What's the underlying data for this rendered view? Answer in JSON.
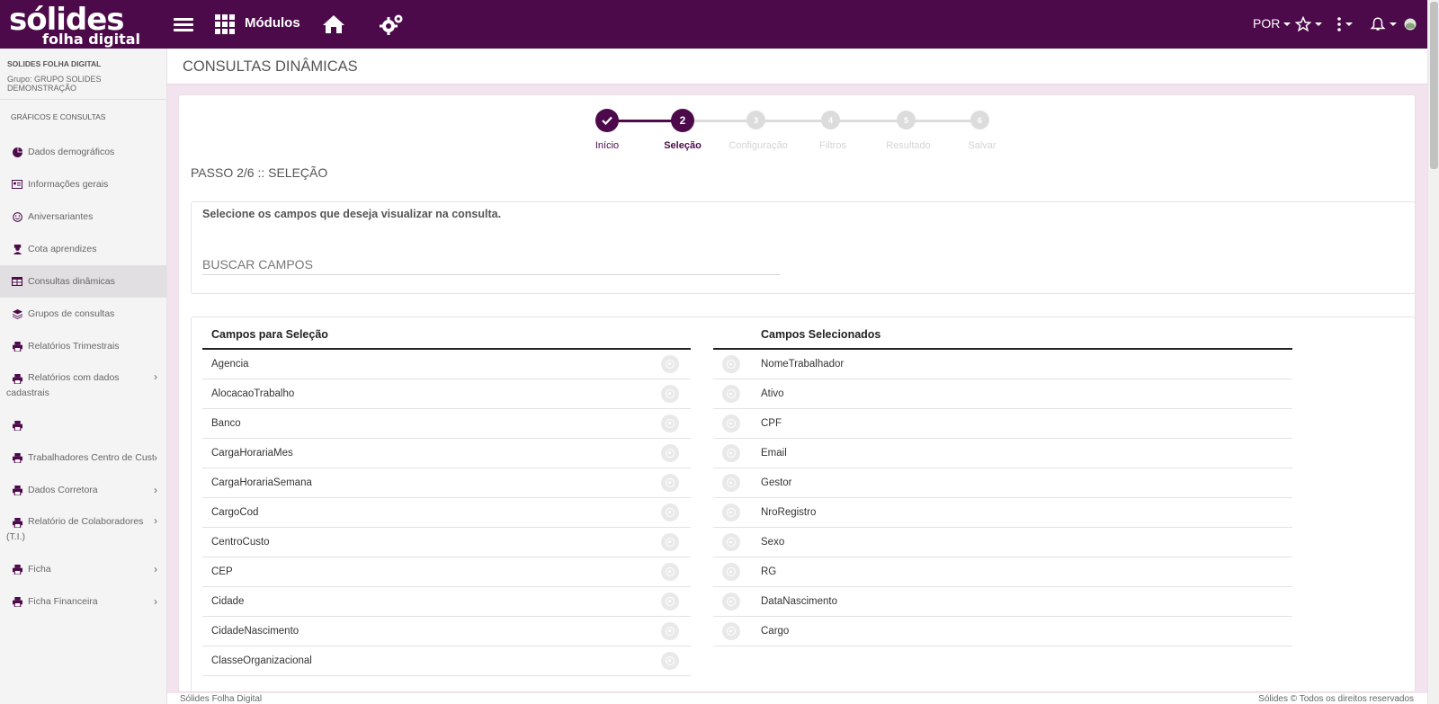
{
  "header": {
    "logo_top": "sólides",
    "logo_bottom": "folha digital",
    "modules_label": "Módulos",
    "language": "POR"
  },
  "sidebar": {
    "org_name": "SOLIDES FOLHA DIGITAL",
    "org_group": "Grupo: GRUPO SOLIDES DEMONSTRAÇÃO",
    "section_title": "GRÁFICOS E CONSULTAS",
    "items": [
      {
        "label": "Dados demográficos",
        "icon": "pie-chart-icon"
      },
      {
        "label": "Informações gerais",
        "icon": "id-card-icon"
      },
      {
        "label": "Aniversariantes",
        "icon": "smile-icon"
      },
      {
        "label": "Cota aprendizes",
        "icon": "graduation-icon"
      },
      {
        "label": "Consultas dinâmicas",
        "icon": "table-icon",
        "active": true
      },
      {
        "label": "Grupos de consultas",
        "icon": "layers-icon"
      },
      {
        "label": "Relatórios Trimestrais",
        "icon": "printer-icon"
      },
      {
        "label": "Relatórios com dados cadastrais",
        "icon": "printer-icon",
        "submenu": true
      },
      {
        "label": "",
        "icon": "printer-icon"
      },
      {
        "label": "Trabalhadores Centro de Custo",
        "icon": "printer-icon",
        "submenu": true
      },
      {
        "label": "Dados Corretora",
        "icon": "printer-icon",
        "submenu": true
      },
      {
        "label": "Relatório de Colaboradores (T.I.)",
        "icon": "printer-icon",
        "submenu": true
      },
      {
        "label": "Ficha",
        "icon": "printer-icon",
        "submenu": true
      },
      {
        "label": "Ficha Financeira",
        "icon": "printer-icon",
        "submenu": true
      }
    ]
  },
  "page": {
    "title": "CONSULTAS DINÂMICAS",
    "step_caption": "PASSO 2/6 :: SELEÇÃO",
    "description": "Selecione os campos que deseja visualizar na consulta.",
    "search_placeholder": "BUSCAR CAMPOS"
  },
  "stepper": {
    "steps": [
      {
        "number": "✓",
        "label": "Início",
        "state": "done"
      },
      {
        "number": "2",
        "label": "Seleção",
        "state": "current"
      },
      {
        "number": "3",
        "label": "Configuração",
        "state": "pending"
      },
      {
        "number": "4",
        "label": "Filtros",
        "state": "pending"
      },
      {
        "number": "5",
        "label": "Resultado",
        "state": "pending"
      },
      {
        "number": "6",
        "label": "Salvar",
        "state": "pending"
      }
    ]
  },
  "available_fields": {
    "title": "Campos para Seleção",
    "items": [
      "Agencia",
      "AlocacaoTrabalho",
      "Banco",
      "CargaHorariaMes",
      "CargaHorariaSemana",
      "CargoCod",
      "CentroCusto",
      "CEP",
      "Cidade",
      "CidadeNascimento",
      "ClasseOrganizacional"
    ]
  },
  "selected_fields": {
    "title": "Campos Selecionados",
    "items": [
      "NomeTrabalhador",
      "Ativo",
      "CPF",
      "Email",
      "Gestor",
      "NroRegistro",
      "Sexo",
      "RG",
      "DataNascimento",
      "Cargo"
    ]
  },
  "footer": {
    "left": "Sólides Folha Digital",
    "right": "Sólides © Todos os direitos reservados"
  },
  "colors": {
    "brand": "#4d0a4b",
    "active_step": "#4d0a4b",
    "pending_step": "#dcdcdc"
  }
}
